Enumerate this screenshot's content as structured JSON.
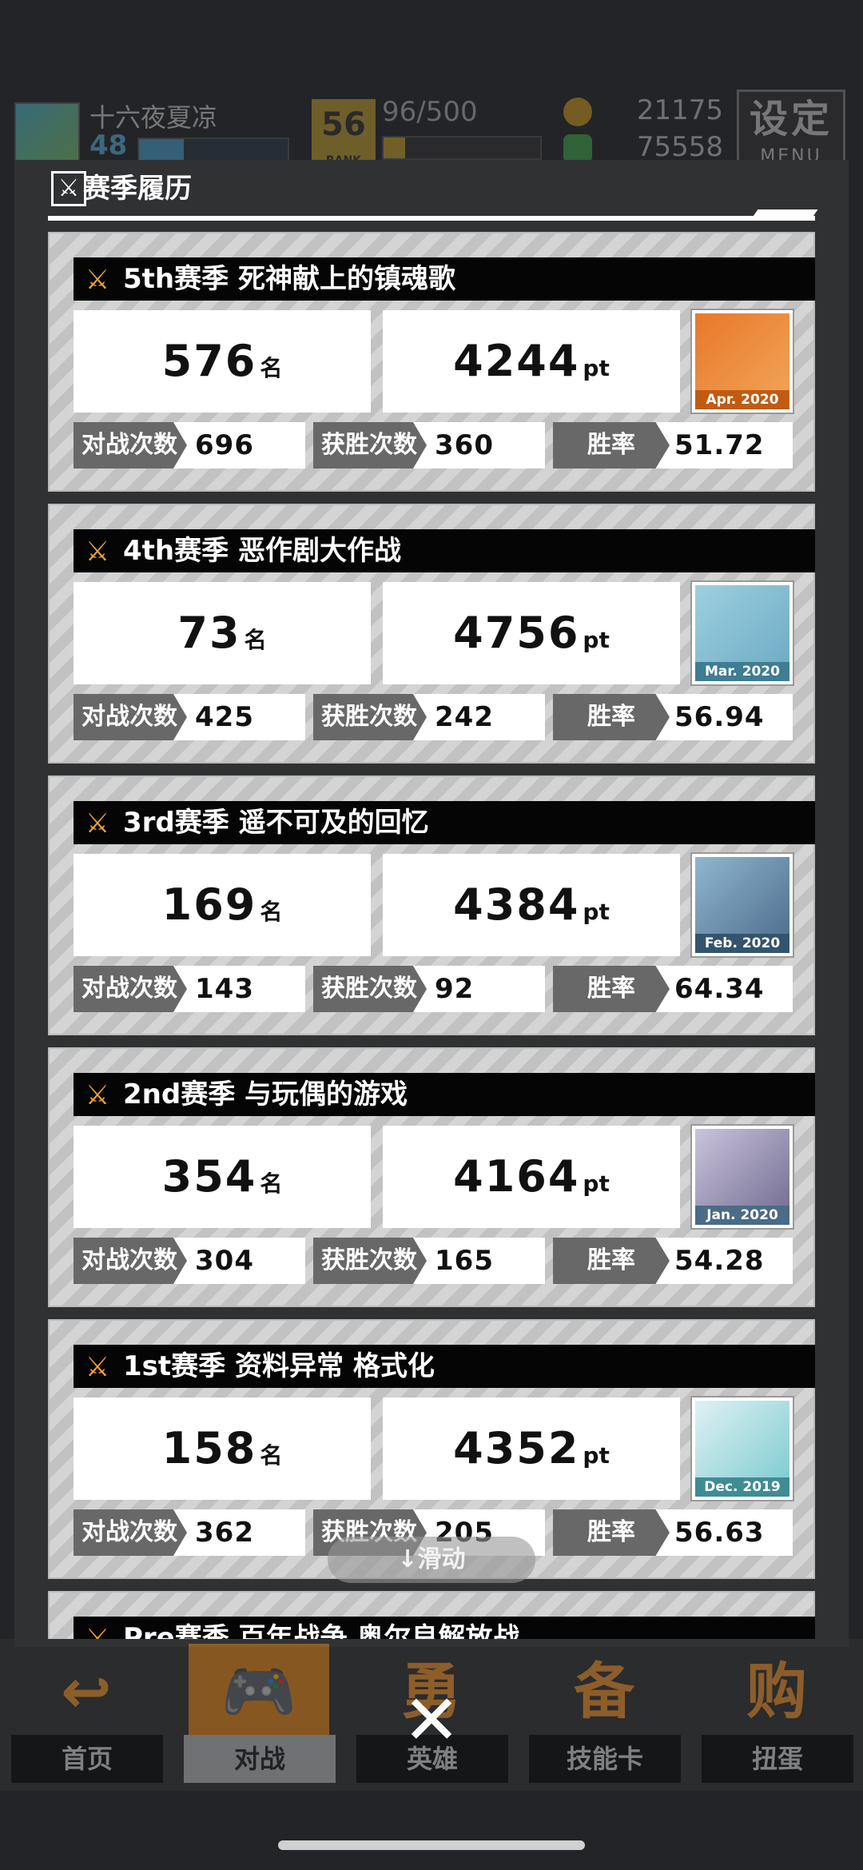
{
  "header": {
    "player_name": "十六夜夏凉",
    "player_level": "48",
    "rank_label": "RANK",
    "rank_value": "96/500",
    "currency1": "21175",
    "currency2": "75558",
    "menu_title": "设定",
    "menu_sub": "MENU"
  },
  "panel": {
    "title": "赛季履历"
  },
  "seasons": [
    {
      "name": "5th赛季  死神献上的镇魂歌",
      "rank": "576",
      "rank_unit": "名",
      "points": "4244",
      "points_unit": "pt",
      "badge": "Apr. 2020",
      "battles_label": "对战次数",
      "battles": "696",
      "wins_label": "获胜次数",
      "wins": "360",
      "rate_label": "胜率",
      "rate": "51.72"
    },
    {
      "name": "4th赛季  恶作剧大作战",
      "rank": "73",
      "rank_unit": "名",
      "points": "4756",
      "points_unit": "pt",
      "badge": "Mar. 2020",
      "battles_label": "对战次数",
      "battles": "425",
      "wins_label": "获胜次数",
      "wins": "242",
      "rate_label": "胜率",
      "rate": "56.94"
    },
    {
      "name": "3rd赛季  遥不可及的回忆",
      "rank": "169",
      "rank_unit": "名",
      "points": "4384",
      "points_unit": "pt",
      "badge": "Feb. 2020",
      "battles_label": "对战次数",
      "battles": "143",
      "wins_label": "获胜次数",
      "wins": "92",
      "rate_label": "胜率",
      "rate": "64.34"
    },
    {
      "name": "2nd赛季  与玩偶的游戏",
      "rank": "354",
      "rank_unit": "名",
      "points": "4164",
      "points_unit": "pt",
      "badge": "Jan. 2020",
      "battles_label": "对战次数",
      "battles": "304",
      "wins_label": "获胜次数",
      "wins": "165",
      "rate_label": "胜率",
      "rate": "54.28"
    },
    {
      "name": "1st赛季  资料异常 格式化",
      "rank": "158",
      "rank_unit": "名",
      "points": "4352",
      "points_unit": "pt",
      "badge": "Dec. 2019",
      "battles_label": "对战次数",
      "battles": "362",
      "wins_label": "获胜次数",
      "wins": "205",
      "rate_label": "胜率",
      "rate": "56.63"
    },
    {
      "name": "Pre赛季  百年战争 奥尔良解放战",
      "rank": "",
      "rank_unit": "",
      "points": "",
      "points_unit": "",
      "badge": "",
      "battles_label": "",
      "battles": "",
      "wins_label": "",
      "wins": "",
      "rate_label": "",
      "rate": ""
    }
  ],
  "scroll_hint": "↓滑动",
  "nav": {
    "items": [
      {
        "label": "首页",
        "glyph": "↩"
      },
      {
        "label": "对战",
        "glyph": "🎮"
      },
      {
        "label": "英雄",
        "glyph": "勇"
      },
      {
        "label": "技能卡",
        "glyph": "备"
      },
      {
        "label": "扭蛋",
        "glyph": "购"
      }
    ]
  },
  "close_label": "✕",
  "colors": {
    "accent_orange": "#f0a23a",
    "bar_black": "#050505",
    "label_gray": "#686868"
  }
}
